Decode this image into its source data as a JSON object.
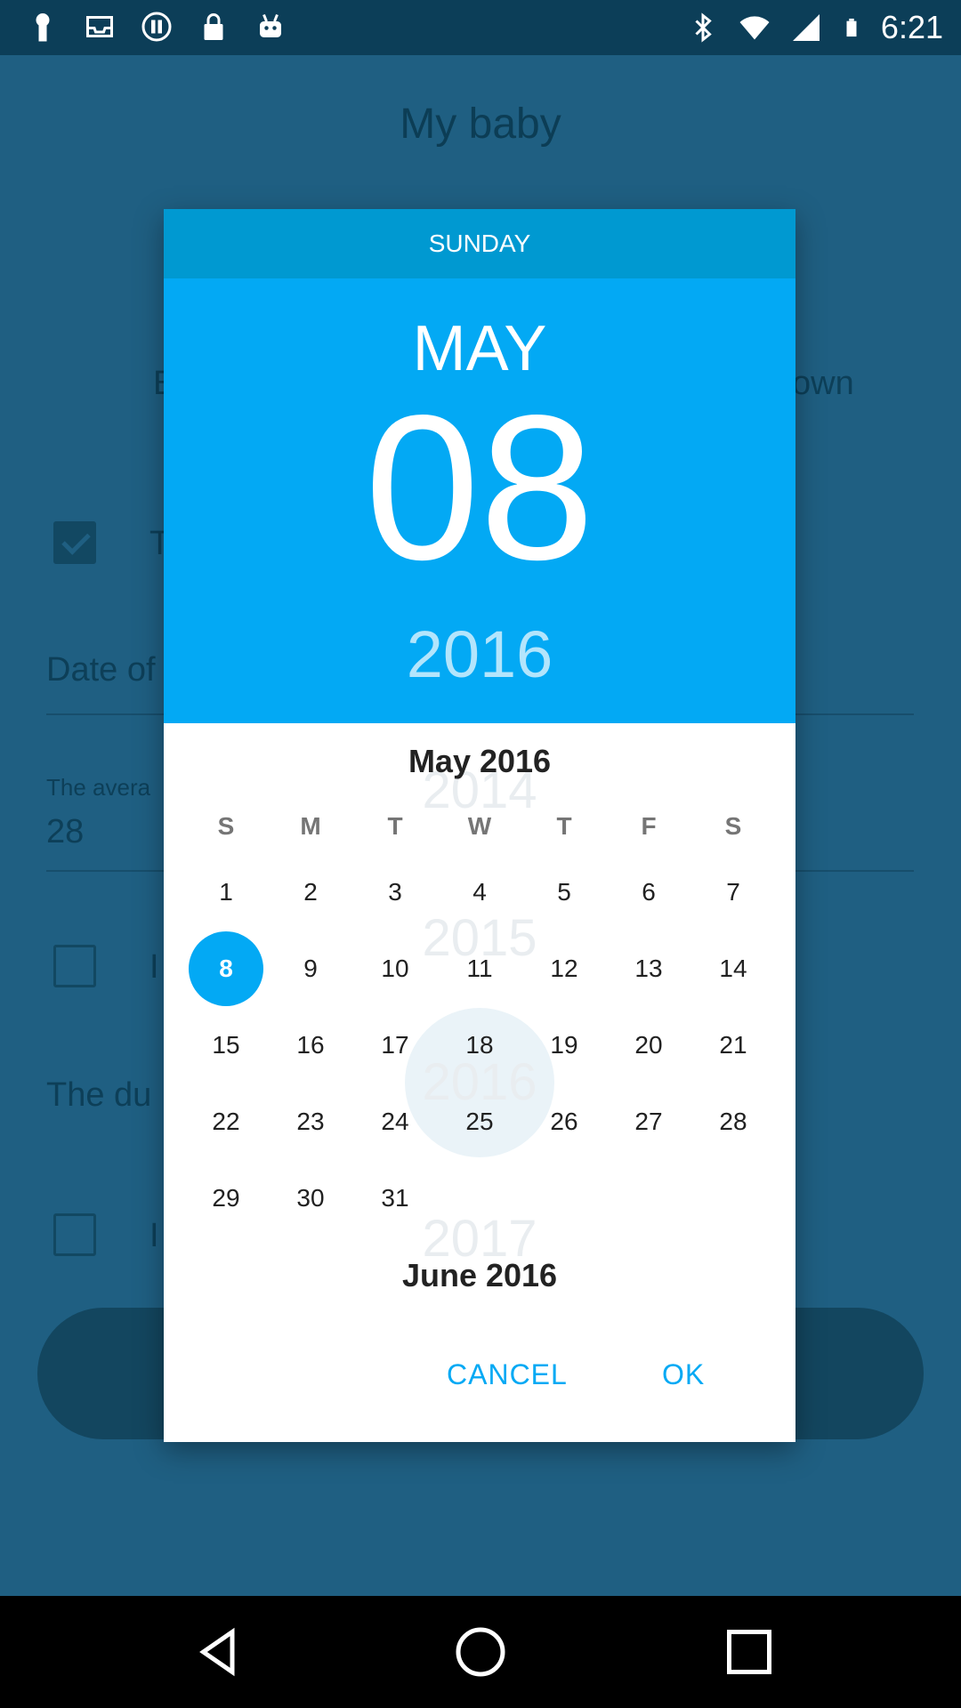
{
  "status_bar": {
    "time": "6:21",
    "left_icons": [
      "keyhole-icon",
      "inbox-icon",
      "pause-circle-icon",
      "lock-icon",
      "android-robot-icon"
    ],
    "right_icons": [
      "bluetooth-icon",
      "wifi-icon",
      "signal-icon",
      "battery-icon"
    ]
  },
  "app": {
    "title": "My baby",
    "prefix_b": "B",
    "suffix_own": "own",
    "label_t": "T",
    "date_label": "Date of",
    "average_label": "The avera",
    "average_value": "28",
    "label_i1": "I",
    "due_label": "The du",
    "label_i2": "I"
  },
  "dialog": {
    "weekday": "SUNDAY",
    "month": "MAY",
    "day": "08",
    "year": "2016",
    "month_title": "May 2016",
    "next_month_title": "June 2016",
    "weekdays": [
      "S",
      "M",
      "T",
      "W",
      "T",
      "F",
      "S"
    ],
    "weeks": [
      [
        "1",
        "2",
        "3",
        "4",
        "5",
        "6",
        "7"
      ],
      [
        "8",
        "9",
        "10",
        "11",
        "12",
        "13",
        "14"
      ],
      [
        "15",
        "16",
        "17",
        "18",
        "19",
        "20",
        "21"
      ],
      [
        "22",
        "23",
        "24",
        "25",
        "26",
        "27",
        "28"
      ],
      [
        "29",
        "30",
        "31",
        "",
        "",
        "",
        ""
      ]
    ],
    "selected_day": "8",
    "ghost_years": [
      "2014",
      "2015",
      "2016",
      "2017"
    ],
    "cancel_label": "CANCEL",
    "ok_label": "OK"
  },
  "colors": {
    "accent": "#03a9f4",
    "header": "#0099d1",
    "dim_background": "#1f5f82"
  },
  "nav_bar": {
    "icons": [
      "back-icon",
      "home-icon",
      "recents-icon"
    ]
  }
}
